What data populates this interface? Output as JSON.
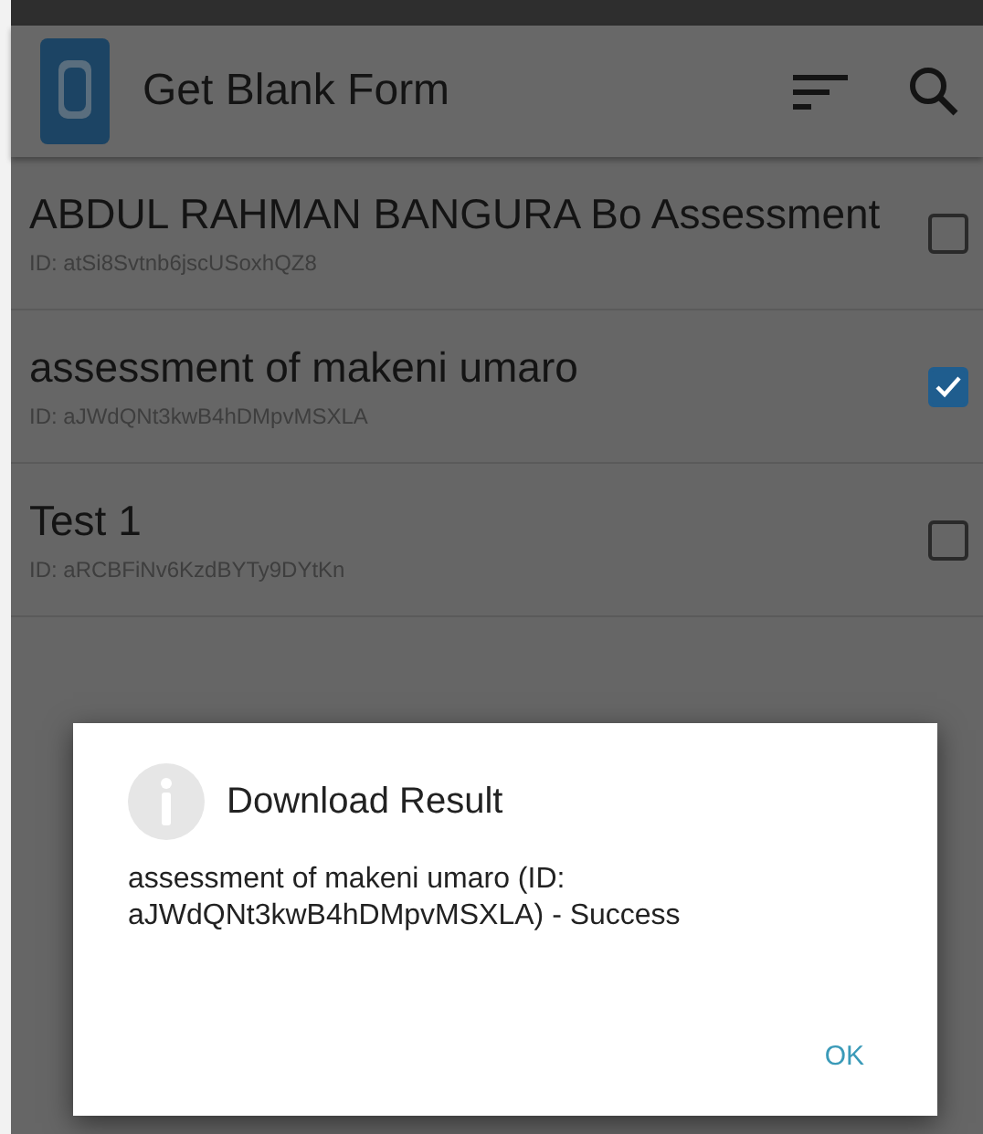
{
  "app_bar": {
    "title": "Get Blank Form"
  },
  "forms": [
    {
      "name": "ABDUL RAHMAN BANGURA Bo Assessment",
      "id_text": "ID: atSi8Svtnb6jscUSoxhQZ8",
      "checked": false
    },
    {
      "name": "assessment of makeni umaro",
      "id_text": "ID: aJWdQNt3kwB4hDMpvMSXLA",
      "checked": true
    },
    {
      "name": "Test 1",
      "id_text": "ID: aRCBFiNv6KzdBYTy9DYtKn",
      "checked": false
    }
  ],
  "dialog": {
    "title": "Download Result",
    "message": "assessment of makeni umaro (ID: aJWdQNt3kwB4hDMpvMSXLA) - Success",
    "buttons": [
      "OK"
    ]
  }
}
